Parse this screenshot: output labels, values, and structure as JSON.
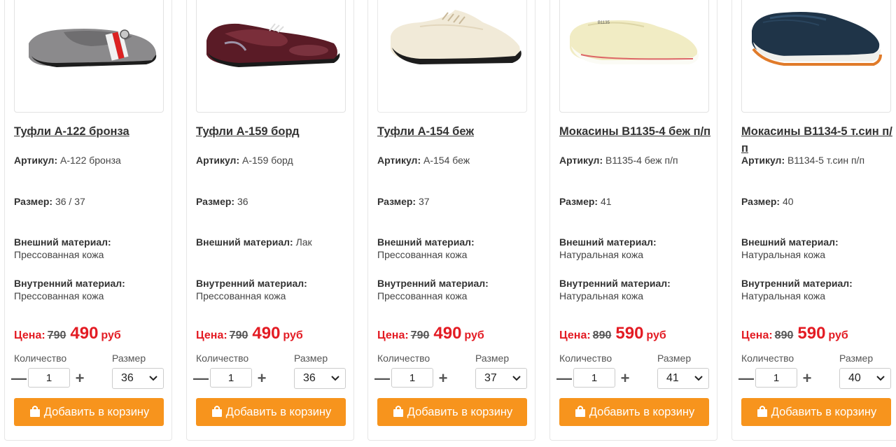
{
  "labels": {
    "article": "Артикул:",
    "size": "Размер:",
    "outer": "Внешний материал:",
    "inner": "Внутренний материал:",
    "price": "Цена:",
    "currency": "руб",
    "quantity": "Количество",
    "size_select": "Размер",
    "add_to_cart": "Добавить в корзину"
  },
  "colors": {
    "accent": "#f7941d",
    "price_red": "#e31b23"
  },
  "products": [
    {
      "title": "Туфли А-122 бронза",
      "article": "А-122 бронза",
      "size": "36 / 37",
      "outer": "Прессованная кожа",
      "inner": "Прессованная кожа",
      "old_price": "790",
      "new_price": "490",
      "qty": "1",
      "size_selected": "36"
    },
    {
      "title": "Туфли А-159 борд",
      "article": "А-159 борд",
      "size": "36",
      "outer": "Лак",
      "inner": "Прессованная кожа",
      "old_price": "790",
      "new_price": "490",
      "qty": "1",
      "size_selected": "36"
    },
    {
      "title": "Туфли А-154 беж",
      "article": "А-154 беж",
      "size": "37",
      "outer": "Прессованная кожа",
      "inner": "Прессованная кожа",
      "old_price": "790",
      "new_price": "490",
      "qty": "1",
      "size_selected": "37"
    },
    {
      "title": "Мокасины В1135-4 беж п/п",
      "article": "В1135-4 беж п/п",
      "size": "41",
      "outer": "Натуральная кожа",
      "inner": "Натуральная кожа",
      "old_price": "890",
      "new_price": "590",
      "qty": "1",
      "size_selected": "41"
    },
    {
      "title": "Мокасины В1134-5 т.син п/п",
      "article": "В1134-5 т.син п/п",
      "size": "40",
      "outer": "Натуральная кожа",
      "inner": "Натуральная кожа",
      "old_price": "890",
      "new_price": "590",
      "qty": "1",
      "size_selected": "40"
    }
  ]
}
